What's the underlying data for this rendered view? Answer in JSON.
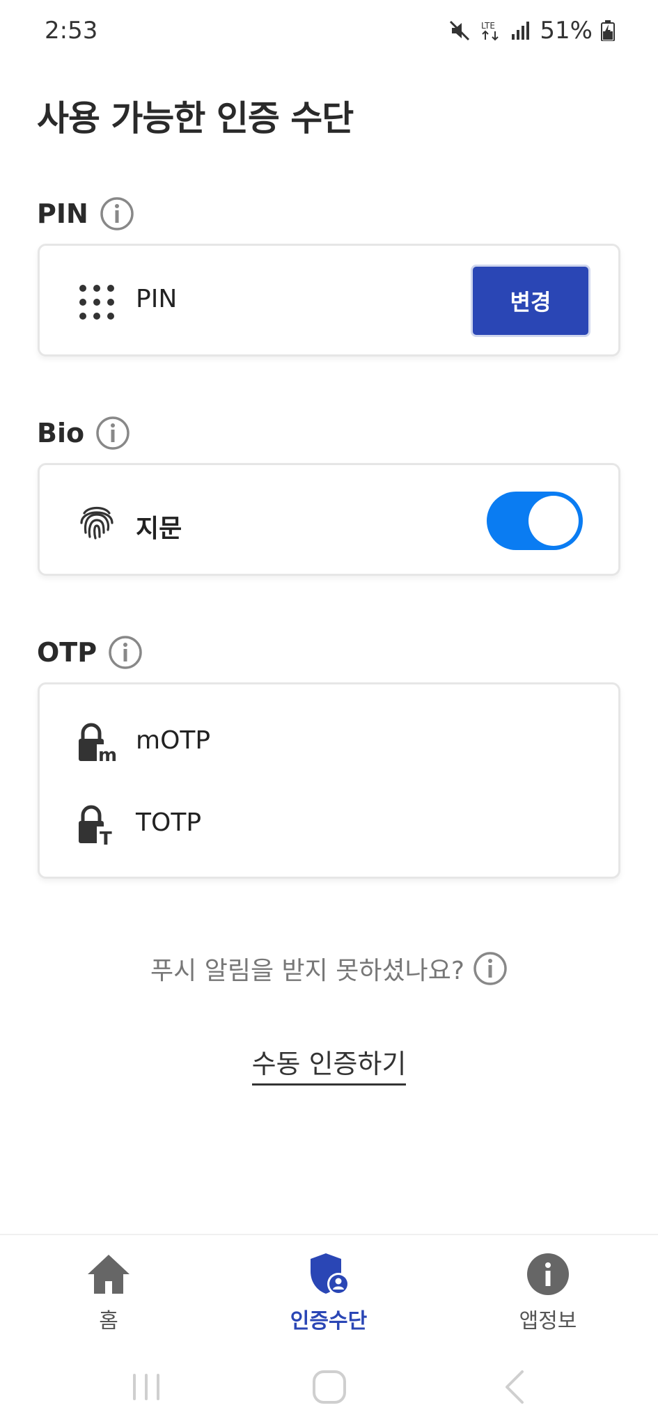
{
  "status_bar": {
    "time": "2:53",
    "network": "LTE",
    "battery": "51%"
  },
  "page": {
    "title": "사용 가능한 인증 수단"
  },
  "sections": {
    "pin": {
      "header": "PIN",
      "item_label": "PIN",
      "change_button": "변경"
    },
    "bio": {
      "header": "Bio",
      "item_label": "지문",
      "toggle_on": true
    },
    "otp": {
      "header": "OTP",
      "items": [
        {
          "label": "mOTP",
          "badge": "m"
        },
        {
          "label": "TOTP",
          "badge": "T"
        }
      ]
    }
  },
  "push": {
    "question": "푸시 알림을 받지 못하셨나요?",
    "manual_link": "수동 인증하기"
  },
  "bottom_nav": {
    "items": [
      {
        "label": "홈",
        "icon": "home-icon",
        "active": false
      },
      {
        "label": "인증수단",
        "icon": "shield-user-icon",
        "active": true
      },
      {
        "label": "앱정보",
        "icon": "info-circle-icon",
        "active": false
      }
    ]
  },
  "colors": {
    "primary": "#2a46b5",
    "toggle": "#0a7cf2",
    "icon_gray": "#666666"
  }
}
